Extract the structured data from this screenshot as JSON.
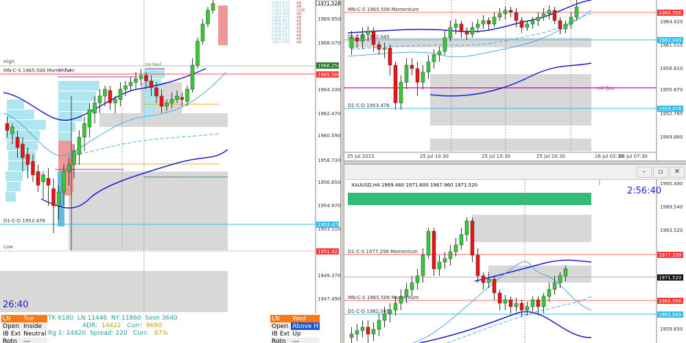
{
  "left": {
    "ticker_prices": [
      "1969.870",
      "1969.593",
      "1969.319",
      "1969.188",
      "1969.037",
      "1968.861",
      "1968.715",
      "1968.564",
      "1968.413",
      "1968.262",
      "1968.111",
      "1967.960"
    ],
    "ticker_codes": [
      "AB",
      "AB",
      "OOB",
      "AB",
      "AB",
      "AB",
      "AB",
      "AB",
      "AB",
      "AB",
      "AB",
      "AB"
    ],
    "axis_labels": [
      "1969.950",
      "1968.070",
      "1964.330",
      "1962.470",
      "1960.590",
      "1958.730",
      "1956.850",
      "1954.970",
      "1953.110",
      "1949.370",
      "1947.490"
    ],
    "badges": {
      "top": "1971.520",
      "green": "1966.254",
      "red": "1965.506",
      "cyan": "1953.476",
      "red2": "1951.421"
    },
    "labels": {
      "high": "High",
      "low": "Low",
      "momentum": "MN-C-S 1965.506 Momentum",
      "d1cd": "D1-C-D 1953.476",
      "h4_tue": "H4 Tue",
      "h4_wed": "H4 Wed",
      "timer": "26:40"
    },
    "tue_table": {
      "header": [
        "LN",
        "Tue"
      ],
      "rows": [
        [
          "Open",
          "Inside"
        ],
        [
          "IB Ext",
          "Neutral"
        ],
        [
          "Rotn",
          "---"
        ]
      ]
    },
    "stats": {
      "line1": [
        "TK 6180",
        "LN 11446",
        "NY 11860",
        "Sesn 3640"
      ],
      "line2": [
        "ADR:",
        "14422",
        "Curr:",
        "9690"
      ],
      "line3": [
        "Rg 1: 14820",
        "Spread: 220",
        "Curr:",
        "67%"
      ]
    },
    "wed_table": {
      "header": [
        "LN",
        "Wed"
      ],
      "rows": [
        [
          "Open",
          "Above H"
        ],
        [
          "IB Ext",
          "Up"
        ],
        [
          "Rotn",
          "---"
        ]
      ]
    }
  },
  "tr": {
    "axis_labels": [
      "1964.420",
      "1961.515",
      "1958.610",
      "1955.670",
      "1952.765",
      "1949.860"
    ],
    "badges": {
      "red": "1965.506",
      "cyan_a": "1962.045",
      "cyan_b": "1953.476"
    },
    "labels": {
      "momentum": "MN-C-S 1965.506 Momentum",
      "d1cd_partial": "D1-C-D 1962.045",
      "h4qlo": "H4 QLo",
      "d1cd": "D1-C-D 1953.476"
    },
    "x_labels": [
      "25 Jul 2023",
      "25 Jul 10:30",
      "25 Jul 15:30",
      "25 Jul 20:30",
      "26 Jul 02:30",
      "26 Jul 07:30"
    ]
  },
  "br": {
    "symbol_line": "XAUUSD,H4  1969.460 1971.600 1967.960 1971.520",
    "timer": "2:56:40",
    "axis_labels": [
      "1995.490",
      "1989.540",
      "1983.520",
      "1977.299",
      "1971.520",
      "1965.506",
      "1962.045",
      "1959.650"
    ],
    "badges": {
      "red_a": "1977.299",
      "black": "1971.520",
      "red_b": "1965.506",
      "cyan": "1962.045"
    },
    "labels": {
      "d1cs": "D1-C-S 1977.299 Momentum",
      "momentum": "MN-C-S 1965.506 Momentum",
      "d1cd": "D1-C-D 1962.045"
    }
  },
  "colors": {
    "bull": "#33cc33",
    "bear": "#ee1111",
    "zone": "#d8d8d8",
    "red_level": "#ff4444",
    "cyan_level": "#33bbee",
    "blue_ma": "#1a1acc",
    "light_ma": "#4aa8e8",
    "magenta": "#dd22aa",
    "green_zone": "#33bb77"
  }
}
